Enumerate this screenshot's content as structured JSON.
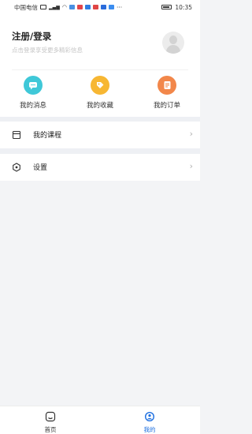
{
  "status_bar": {
    "carrier": "中国电信",
    "time": "10:35"
  },
  "profile": {
    "login_title": "注册/登录",
    "login_subtitle": "点击登录享受更多精彩信息"
  },
  "quick_actions": [
    {
      "label": "我的消息",
      "icon": "chat-bubble-icon",
      "color": "#3fc8d8"
    },
    {
      "label": "我的收藏",
      "icon": "tag-icon",
      "color": "#f7b733"
    },
    {
      "label": "我的订单",
      "icon": "order-document-icon",
      "color": "#f2874a"
    }
  ],
  "menu": [
    {
      "label": "我的课程",
      "icon": "course-book-icon"
    },
    {
      "label": "设置",
      "icon": "settings-hexagon-icon"
    }
  ],
  "tab_bar": {
    "home_label": "首页",
    "mine_label": "我的",
    "active_color": "#1d6fe0",
    "inactive_color": "#333333"
  }
}
